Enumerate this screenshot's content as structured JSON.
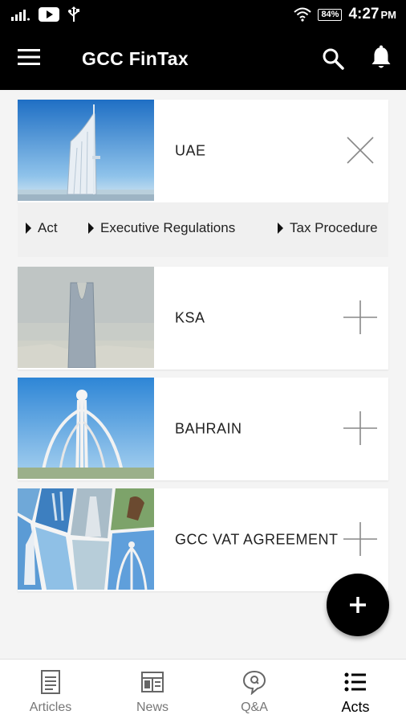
{
  "status_bar": {
    "battery": "84%",
    "time": "4:27",
    "ampm": "PM"
  },
  "app_bar": {
    "title": "GCC FinTax"
  },
  "cards": [
    {
      "label": "UAE",
      "expanded": true
    },
    {
      "label": "KSA",
      "expanded": false
    },
    {
      "label": "BAHRAIN",
      "expanded": false
    },
    {
      "label": "GCC VAT AGREEMENT",
      "expanded": false
    }
  ],
  "subnav": {
    "items": [
      "Act",
      "Executive Regulations",
      "Tax Procedure"
    ]
  },
  "bottom_nav": {
    "items": [
      {
        "label": "Articles",
        "icon": "document-icon"
      },
      {
        "label": "News",
        "icon": "newspaper-icon"
      },
      {
        "label": "Q&A",
        "icon": "qa-bubble-icon"
      },
      {
        "label": "Acts",
        "icon": "list-icon"
      }
    ],
    "active": "Acts"
  },
  "colors": {
    "bar_bg": "#000000",
    "card_bg": "#ffffff",
    "page_bg": "#f4f4f4"
  }
}
